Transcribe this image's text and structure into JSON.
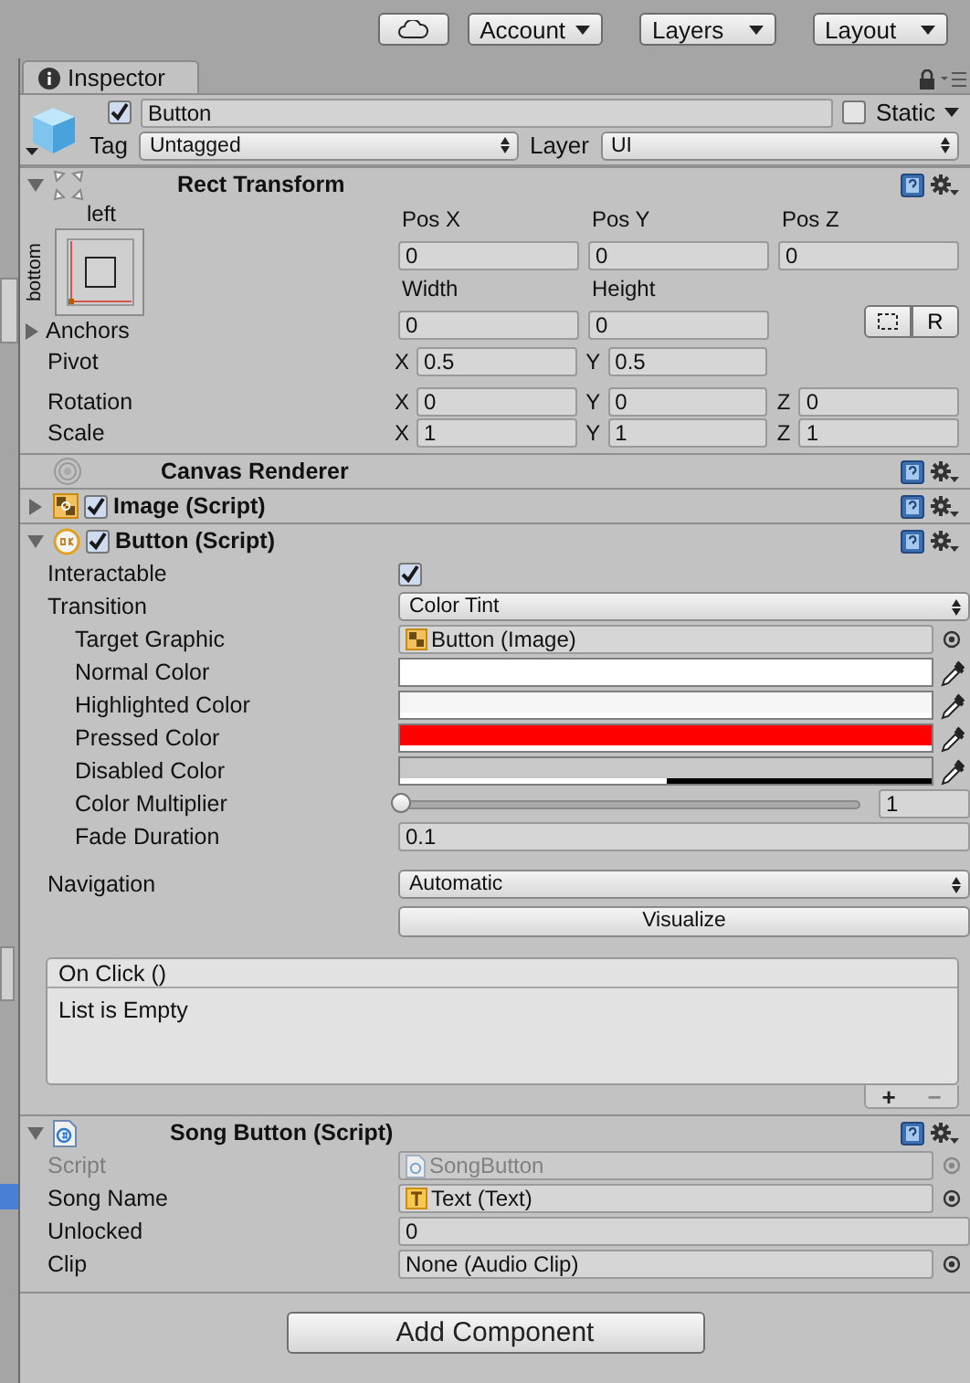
{
  "toolbar": {
    "buttons": [
      {
        "kind": "cloud"
      },
      {
        "kind": "dropdown",
        "label": "Account"
      },
      {
        "kind": "dropdown",
        "label": "Layers"
      },
      {
        "kind": "dropdown",
        "label": "Layout"
      }
    ]
  },
  "tab": {
    "title": "Inspector"
  },
  "game_object": {
    "active": true,
    "name": "Button",
    "static": false,
    "static_label": "Static",
    "tag_label": "Tag",
    "tag": "Untagged",
    "layer_label": "Layer",
    "layer": "UI"
  },
  "components": [
    {
      "kind": "rect",
      "title": "Rect Transform",
      "expanded": true,
      "anchor_top": "left",
      "anchor_side": "bottom",
      "position": [
        {
          "label": "Pos X",
          "value": "0"
        },
        {
          "label": "Pos Y",
          "value": "0"
        },
        {
          "label": "Pos Z",
          "value": "0"
        }
      ],
      "size": [
        {
          "label": "Width",
          "value": "0"
        },
        {
          "label": "Height",
          "value": "0"
        }
      ],
      "raw_button": "R",
      "anchors": {
        "label": "Anchors",
        "expanded": false
      },
      "rows": [
        {
          "label": "Pivot",
          "axes": [
            {
              "axis": "X",
              "value": "0.5"
            },
            {
              "axis": "Y",
              "value": "0.5"
            }
          ]
        },
        {
          "label": "Rotation",
          "axes": [
            {
              "axis": "X",
              "value": "0"
            },
            {
              "axis": "Y",
              "value": "0"
            },
            {
              "axis": "Z",
              "value": "0"
            }
          ]
        },
        {
          "label": "Scale",
          "axes": [
            {
              "axis": "X",
              "value": "1"
            },
            {
              "axis": "Y",
              "value": "1"
            },
            {
              "axis": "Z",
              "value": "1"
            }
          ]
        }
      ]
    },
    {
      "kind": "renderer",
      "title": "Canvas Renderer"
    },
    {
      "kind": "image",
      "title": "Image (Script)",
      "enabled": true,
      "expanded": false
    },
    {
      "kind": "button",
      "title": "Button (Script)",
      "enabled": true,
      "expanded": true,
      "properties": [
        {
          "kind": "checkbox",
          "label": "Interactable",
          "checked": true
        },
        {
          "kind": "dropdown",
          "label": "Transition",
          "value": "Color Tint",
          "children": [
            {
              "kind": "image_ref",
              "label": "Target Graphic",
              "value": "Button (Image)"
            },
            {
              "kind": "color",
              "label": "Normal Color",
              "color": "#ffffff",
              "level": 1
            },
            {
              "kind": "color",
              "label": "Highlighted Color",
              "color": "#f5f5f5",
              "level": 1
            },
            {
              "kind": "color",
              "label": "Pressed Color",
              "color": "#ff0000",
              "level": 1
            },
            {
              "kind": "color",
              "label": "Disabled Color",
              "color": "#c8c8c8",
              "level": 0.5
            },
            {
              "kind": "slider",
              "label": "Color Multiplier",
              "level": 0,
              "reading": "1"
            },
            {
              "kind": "number",
              "label": "Fade Duration",
              "value": "0.1"
            }
          ]
        }
      ],
      "navigation": {
        "label": "Navigation",
        "value": "Automatic",
        "button": "Visualize"
      },
      "event": {
        "title": "On Click ()",
        "empty_text": "List is Empty",
        "add": "+",
        "remove": "−"
      }
    },
    {
      "kind": "script",
      "title": "Song Button (Script)",
      "expanded": true,
      "properties": [
        {
          "kind": "script_ref",
          "label": "Script",
          "value": "SongButton",
          "disabled": true
        },
        {
          "kind": "text_ref",
          "label": "Song Name",
          "value": "Text (Text)"
        },
        {
          "kind": "number",
          "label": "Unlocked",
          "value": "0"
        },
        {
          "kind": "object",
          "label": "Clip",
          "value": "None (Audio Clip)"
        }
      ]
    }
  ],
  "add_component": "Add Component"
}
